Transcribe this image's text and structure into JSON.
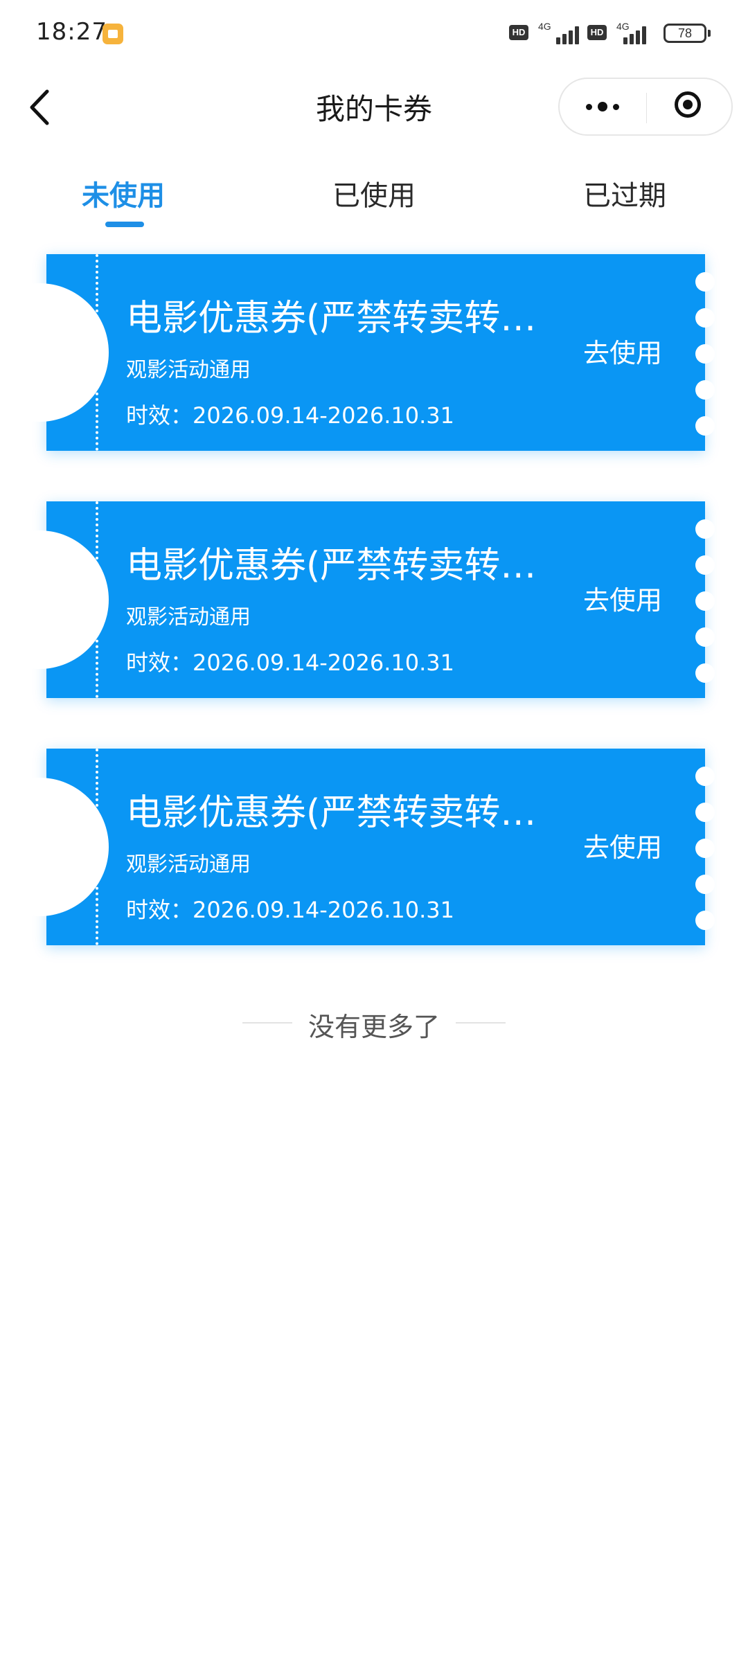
{
  "status_bar": {
    "time": "18:27",
    "sim1": {
      "badge": "HD",
      "network": "4G"
    },
    "sim2": {
      "badge": "HD",
      "network": "4G"
    },
    "battery": "78"
  },
  "header": {
    "title": "我的卡券",
    "back_icon": "chevron-left-icon",
    "more_icon": "more-dots-icon",
    "close_icon": "target-circle-icon"
  },
  "tabs": [
    {
      "label": "未使用",
      "active": true
    },
    {
      "label": "已使用",
      "active": false
    },
    {
      "label": "已过期",
      "active": false
    }
  ],
  "coupons": [
    {
      "title": "电影优惠券(严禁转卖转…",
      "subtitle": "观影活动通用",
      "validity": "时效：2026.09.14-2026.10.31",
      "action": "去使用"
    },
    {
      "title": "电影优惠券(严禁转卖转…",
      "subtitle": "观影活动通用",
      "validity": "时效：2026.09.14-2026.10.31",
      "action": "去使用"
    },
    {
      "title": "电影优惠券(严禁转卖转…",
      "subtitle": "观影活动通用",
      "validity": "时效：2026.09.14-2026.10.31",
      "action": "去使用"
    }
  ],
  "footer_note": "没有更多了",
  "colors": {
    "accent": "#1e8fe6",
    "coupon_bg": "#0a96f4",
    "text": "#1f1f1f"
  }
}
